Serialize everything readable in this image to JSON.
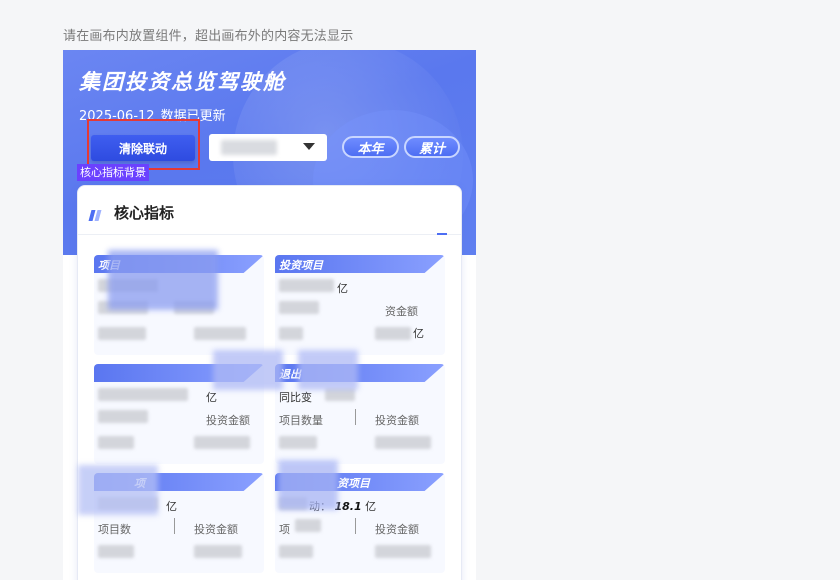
{
  "hint_text": "请在画布内放置组件，超出画布外的内容无法显示",
  "hero": {
    "title": "集团投资总览驾驶舱",
    "date": "2025-06-12",
    "updated": "数据已更新",
    "clear_button": "清除联动",
    "tag": "核心指标背景",
    "pill_year": "本年",
    "pill_total": "累计"
  },
  "panel": {
    "title": "核心指标",
    "cards": [
      {
        "ribbon": "项目",
        "line1_label": "",
        "line1_value": "",
        "line1_unit": "",
        "lab1": "",
        "lab2": ""
      },
      {
        "ribbon": "投资项目",
        "line1_label": "",
        "line1_value": "",
        "line1_unit": "亿",
        "lab1": "",
        "lab2": "资金额"
      },
      {
        "ribbon": "",
        "line1_label": "",
        "line1_value": "",
        "line1_unit": "亿",
        "lab1": "",
        "lab2": "投资金额"
      },
      {
        "ribbon": "退出",
        "line1_label": "同比变",
        "line1_value": "",
        "line1_unit": "",
        "lab1": "项目数量",
        "lab2": "投资金额"
      },
      {
        "ribbon": "项",
        "line1_label": "",
        "line1_value": "",
        "line1_unit": "亿",
        "lab1": "项目数",
        "lab2": "投资金额"
      },
      {
        "ribbon": "资项目",
        "line1_label": "动：",
        "line1_value": "18.1",
        "line1_unit": "亿",
        "lab1": "项",
        "lab2": "投资金额"
      }
    ]
  },
  "colors": {
    "hero_blue": "#5a78ee",
    "button_blue": "#2e4be0",
    "highlight_red": "#e53935",
    "tag_purple": "#6b41ff"
  }
}
